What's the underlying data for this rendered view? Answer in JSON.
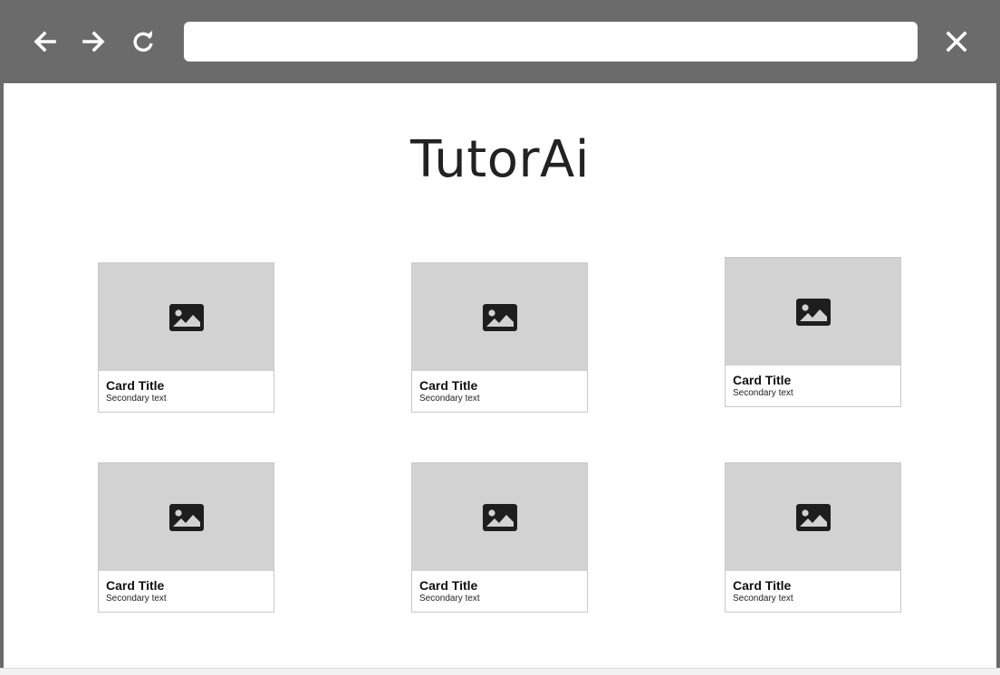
{
  "browser": {
    "address_value": "",
    "icons": {
      "back": "arrow-left-icon",
      "forward": "arrow-right-icon",
      "reload": "reload-icon",
      "close": "close-icon"
    }
  },
  "page": {
    "title": "TutorAi"
  },
  "cards": [
    {
      "title": "Card Title",
      "secondary": "Secondary text",
      "icon": "image-icon"
    },
    {
      "title": "Card Title",
      "secondary": "Secondary text",
      "icon": "image-icon"
    },
    {
      "title": "Card Title",
      "secondary": "Secondary text",
      "icon": "image-icon"
    },
    {
      "title": "Card Title",
      "secondary": "Secondary text",
      "icon": "image-icon"
    },
    {
      "title": "Card Title",
      "secondary": "Secondary text",
      "icon": "image-icon"
    },
    {
      "title": "Card Title",
      "secondary": "Secondary text",
      "icon": "image-icon"
    }
  ],
  "colors": {
    "chrome": "#6b6b6b",
    "placeholder": "#d2d2d2",
    "card_border": "#c9c9c9"
  }
}
